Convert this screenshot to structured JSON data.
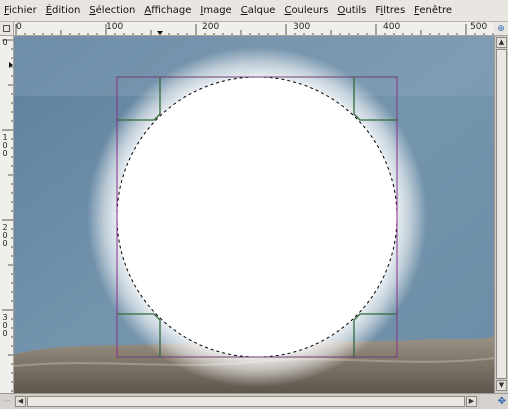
{
  "menu": [
    {
      "label": "Fichier",
      "mnemonic_index": 0
    },
    {
      "label": "Édition",
      "mnemonic_index": 0
    },
    {
      "label": "Sélection",
      "mnemonic_index": 0
    },
    {
      "label": "Affichage",
      "mnemonic_index": 0
    },
    {
      "label": "Image",
      "mnemonic_index": 0
    },
    {
      "label": "Calque",
      "mnemonic_index": 0
    },
    {
      "label": "Couleurs",
      "mnemonic_index": 0
    },
    {
      "label": "Outils",
      "mnemonic_index": 0
    },
    {
      "label": "Filtres",
      "mnemonic_index": 1
    },
    {
      "label": "Fenêtre",
      "mnemonic_index": 0
    }
  ],
  "ruler": {
    "horizontal_labels": [
      "0",
      "100",
      "200",
      "300",
      "400",
      "500"
    ],
    "vertical_labels": [
      "0",
      "1 0 0",
      "2 0 0",
      "3 0 0"
    ]
  },
  "colors": {
    "water": "#6f8fa8",
    "rock": "#8a8176",
    "glow": "#ffffff",
    "guide_magenta": "#8a2f8c",
    "guide_green": "#2f6b3a",
    "accent_blue": "#2a64b0"
  },
  "icons": {
    "ruler_corner": "square-icon",
    "navigate": "navigate-icon",
    "scroll_up": "arrow-up-icon",
    "scroll_down": "arrow-down-icon",
    "scroll_left": "arrow-left-icon",
    "scroll_right": "arrow-right-icon"
  }
}
